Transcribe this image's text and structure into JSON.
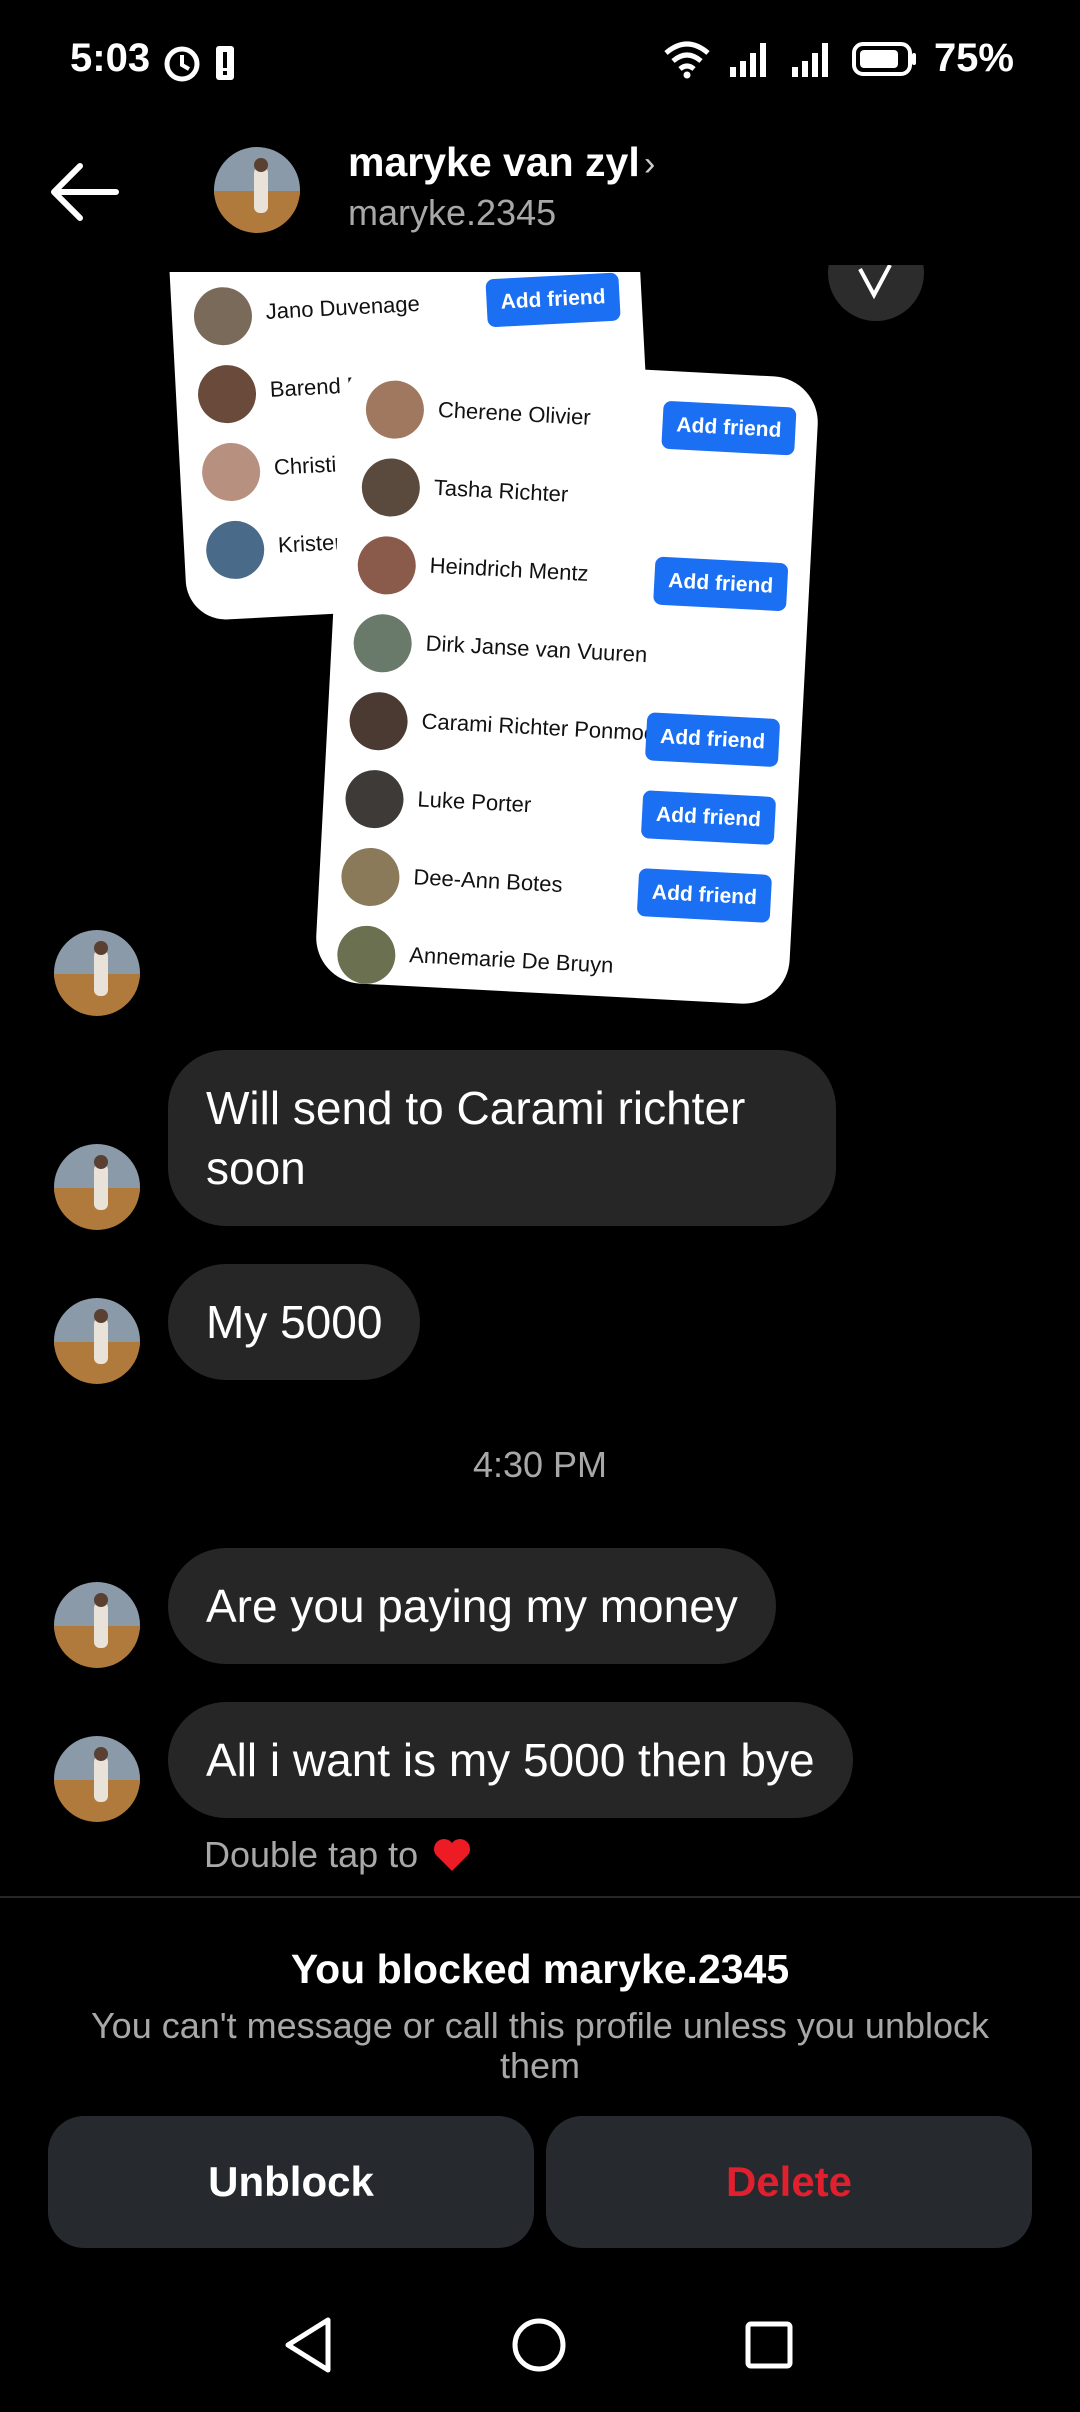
{
  "status": {
    "time": "5:03",
    "battery": "75%"
  },
  "header": {
    "name": "maryke van zyl",
    "handle": "maryke.2345",
    "chevron": "›"
  },
  "shared_back_card": {
    "rows": [
      {
        "name": "Jano Duvenage",
        "button": "Add friend"
      },
      {
        "name": "Barend Ro",
        "button": ""
      },
      {
        "name": "Christi Bo",
        "button": ""
      },
      {
        "name": "Kristen",
        "button": ""
      }
    ]
  },
  "shared_front_card": {
    "rows": [
      {
        "name": "Cherene Olivier",
        "button": "Add friend"
      },
      {
        "name": "Tasha Richter",
        "button": ""
      },
      {
        "name": "Heindrich Mentz",
        "button": "Add friend"
      },
      {
        "name": "Dirk Janse van Vuuren",
        "button": ""
      },
      {
        "name": "Carami Richter Ponmoon",
        "button": "Add friend"
      },
      {
        "name": "Luke Porter",
        "button": "Add friend"
      },
      {
        "name": "Dee-Ann Botes",
        "button": "Add friend"
      },
      {
        "name": "Annemarie De Bruyn",
        "button": ""
      }
    ]
  },
  "messages": [
    {
      "text": "Will send to Carami richter soon"
    },
    {
      "text": "My 5000"
    },
    {
      "text": "Are you paying my money"
    },
    {
      "text": "All i want is my 5000 then bye"
    }
  ],
  "timestamp": "4:30 PM",
  "hint": "Double tap to",
  "hint_icon": "heart-icon",
  "blocked": {
    "title": "You blocked maryke.2345",
    "subtitle": "You can't message or call this profile unless you unblock them",
    "unblock_label": "Unblock",
    "delete_label": "Delete"
  },
  "colors": {
    "accent_blue": "#1a6ff3",
    "delete_red": "#e0202e",
    "bubble": "#262626"
  }
}
